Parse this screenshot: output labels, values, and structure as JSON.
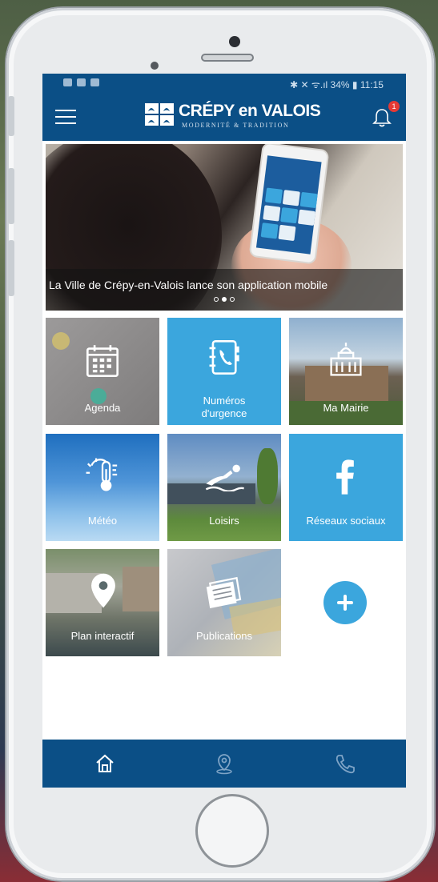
{
  "status_bar": {
    "right": "✱ ✕ ᯤ.ıl 34% ▮ 11:15"
  },
  "app_bar": {
    "logo_title": "CRÉPY en VALOIS",
    "logo_subtitle": "MODERNITÉ & TRADITION",
    "notification_count": "1"
  },
  "hero": {
    "caption": "La Ville de Crépy-en-Valois lance son application mobile",
    "slide_count": 3,
    "active_slide": 2
  },
  "tiles": [
    {
      "label": "Agenda",
      "icon": "calendar-icon"
    },
    {
      "label": "Numéros d'urgence",
      "icon": "phonebook-icon"
    },
    {
      "label": "Ma Mairie",
      "icon": "town-hall-icon"
    },
    {
      "label": "Météo",
      "icon": "weather-icon"
    },
    {
      "label": "Loisirs",
      "icon": "swimmer-icon"
    },
    {
      "label": "Réseaux sociaux",
      "icon": "facebook-icon"
    },
    {
      "label": "Plan interactif",
      "icon": "map-pin-icon"
    },
    {
      "label": "Publications",
      "icon": "newspaper-icon"
    }
  ],
  "add_tile_icon": "plus-icon",
  "bottom_nav": [
    {
      "icon": "home-icon"
    },
    {
      "icon": "location-icon"
    },
    {
      "icon": "phone-icon"
    }
  ],
  "colors": {
    "primary": "#0b4f86",
    "accent": "#3ba6dd",
    "badge": "#e53935"
  }
}
